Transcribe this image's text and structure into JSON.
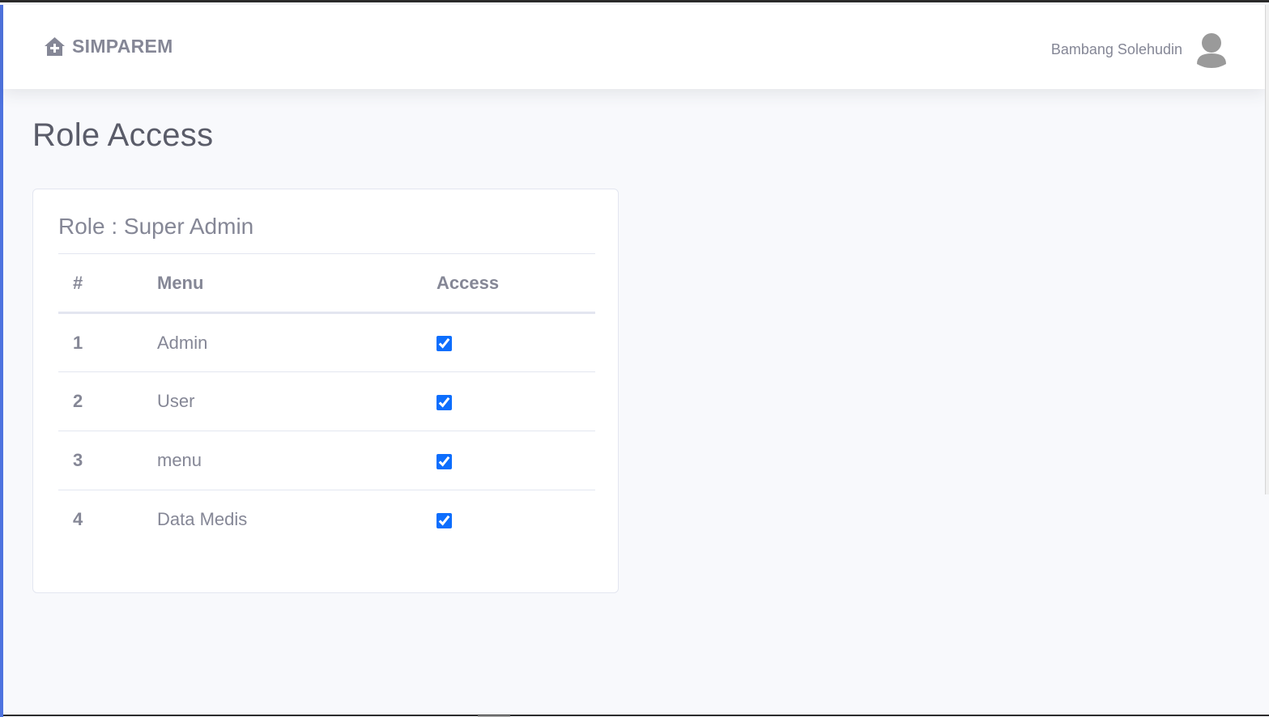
{
  "brand": {
    "name": "SIMPAREM",
    "icon": "house-plus-icon"
  },
  "user": {
    "name": "Bambang Solehudin",
    "avatar_icon": "user-avatar-icon"
  },
  "page": {
    "title": "Role Access"
  },
  "role_card": {
    "heading": "Role : Super Admin",
    "columns": {
      "number": "#",
      "menu": "Menu",
      "access": "Access"
    },
    "rows": [
      {
        "number": "1",
        "menu": "Admin",
        "access": true
      },
      {
        "number": "2",
        "menu": "User",
        "access": true
      },
      {
        "number": "3",
        "menu": "menu",
        "access": true
      },
      {
        "number": "4",
        "menu": "Data Medis",
        "access": true
      }
    ]
  },
  "colors": {
    "accent_edge": "#4e73df",
    "checkbox": "#0d6efd",
    "text_muted": "#858796",
    "background": "#f8f9fc"
  }
}
